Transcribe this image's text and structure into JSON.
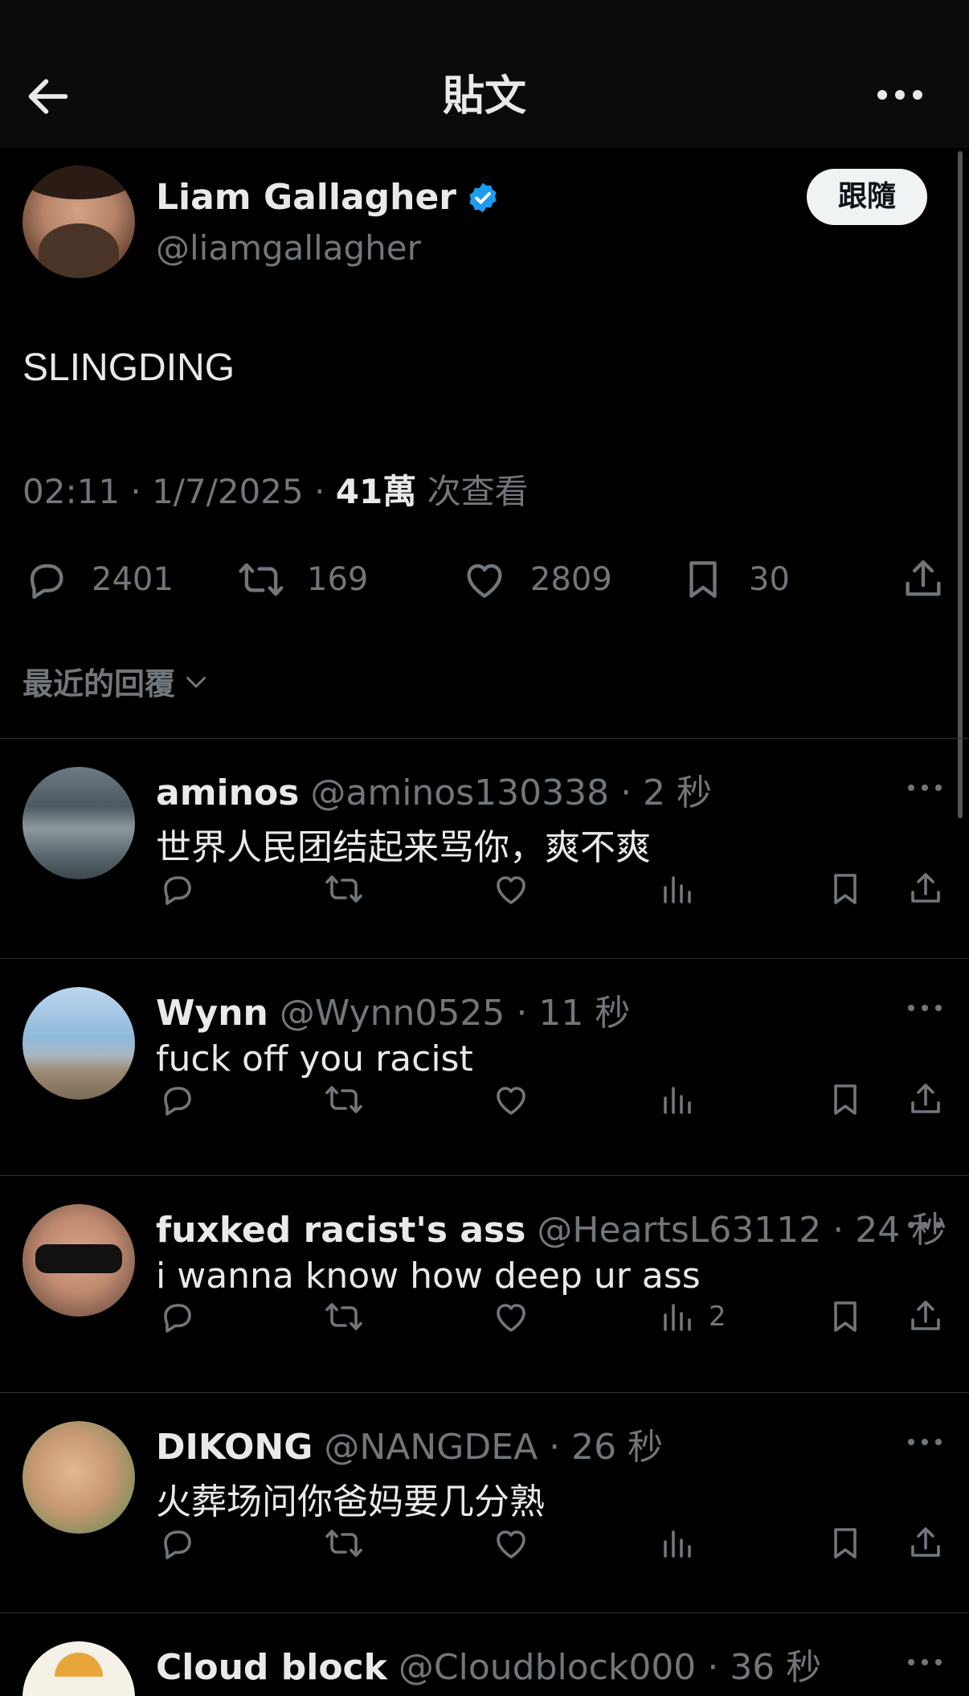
{
  "topbar": {
    "title": "貼文"
  },
  "post": {
    "author_name": "Liam Gallagher",
    "author_handle": "@liamgallagher",
    "follow_label": "跟隨",
    "text": "SLINGDING",
    "time": "02:11 · 1/7/2025 · ",
    "views_count": "41萬",
    "views_suffix": " 次查看",
    "stats": {
      "replies": "2401",
      "reposts": "169",
      "likes": "2809",
      "bookmarks": "30"
    },
    "sort_label": "最近的回覆"
  },
  "replies": [
    {
      "name": "aminos",
      "handle": "@aminos130338",
      "time": "2 秒",
      "text": "世界人民团结起来骂你，爽不爽",
      "views": ""
    },
    {
      "name": "Wynn",
      "handle": "@Wynn0525",
      "time": "11 秒",
      "text": "fuck off you racist",
      "views": ""
    },
    {
      "name": "fuxked racist's ass",
      "handle": "@HeartsL63112",
      "time": "24 秒",
      "text": "i wanna know how deep ur ass",
      "views": "2"
    },
    {
      "name": "DIKONG",
      "handle": "@NANGDEA",
      "time": "26 秒",
      "text": "火葬场问你爸妈要几分熟",
      "views": ""
    },
    {
      "name": "Cloud block",
      "handle": "@Cloudblock000",
      "time": "36 秒",
      "text": "",
      "views": ""
    }
  ],
  "colors": {
    "background": "#000000",
    "topbar": "#0b0b0b",
    "text": "#e7e9ea",
    "muted": "#71767b",
    "verified": "#1d9bf0",
    "divider": "#2f3336"
  },
  "icons": [
    "back-arrow-icon",
    "more-horizontal-icon",
    "verified-badge-icon",
    "reply-icon",
    "repost-icon",
    "like-icon",
    "views-icon",
    "bookmark-icon",
    "share-icon",
    "chevron-down-icon"
  ]
}
